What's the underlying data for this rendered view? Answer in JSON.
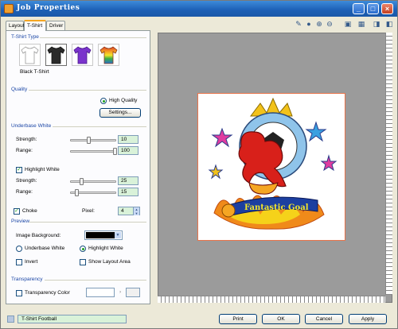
{
  "window": {
    "title": "Job Properties"
  },
  "tabs": [
    {
      "label": "Layout"
    },
    {
      "label": "T-Shirt"
    },
    {
      "label": "Driver"
    }
  ],
  "tshirt_type": {
    "section_title": "T-Shirt Type",
    "selected_label": "Black T-Shirt",
    "swatches": [
      {
        "name": "white",
        "color": "#ffffff"
      },
      {
        "name": "black",
        "color": "#2a2a2a"
      },
      {
        "name": "purple",
        "color": "#7a33cc"
      },
      {
        "name": "rainbow",
        "color": "#e0402a"
      }
    ]
  },
  "quality": {
    "section_title": "Quality",
    "high_quality_label": "High Quality",
    "settings_button": "Settings..."
  },
  "underbase_white": {
    "section_title": "Underbase White",
    "strength_label": "Strength:",
    "strength_value": "10",
    "range_label": "Range:",
    "range_value": "100"
  },
  "highlight_white": {
    "checkbox_label": "Highlight White",
    "checked": true,
    "strength_label": "Strength:",
    "strength_value": "25",
    "range_label": "Range:",
    "range_value": "15"
  },
  "choke": {
    "checkbox_label": "Choke",
    "checked": true,
    "pixel_label": "Pixel:",
    "pixel_value": "4"
  },
  "preview": {
    "section_title": "Preview",
    "image_background_label": "Image Background:",
    "image_background_color": "#000000",
    "underbase_white_radio": "Underbase White",
    "highlight_white_radio": "Highlight White",
    "selected": "highlight_white",
    "invert_label": "Invert",
    "show_layout_area_label": "Show Layout Area"
  },
  "transparency": {
    "section_title": "Transparency",
    "transparency_color_label": "Transparency Color"
  },
  "toolbar": {
    "icons": [
      "eyedropper-icon",
      "pan-hand-icon",
      "zoom-in-icon",
      "zoom-out-icon",
      "fit-page-icon",
      "actual-size-icon",
      "rotate-icon",
      "settings-icon"
    ]
  },
  "artwork": {
    "banner_text": "Fantastic Goal"
  },
  "status": {
    "filename": "T-Shirt Football"
  },
  "buttons": {
    "print": "Print",
    "ok": "OK",
    "cancel": "Cancel",
    "apply": "Apply"
  },
  "colors": {
    "titlebar": "#1c5fb5",
    "tab_accent": "#f5a623",
    "section_title": "#1c47a6",
    "canvas": "#9b9b9b",
    "artboard_border": "#e8734a",
    "value_field": "#d9f2d9"
  }
}
